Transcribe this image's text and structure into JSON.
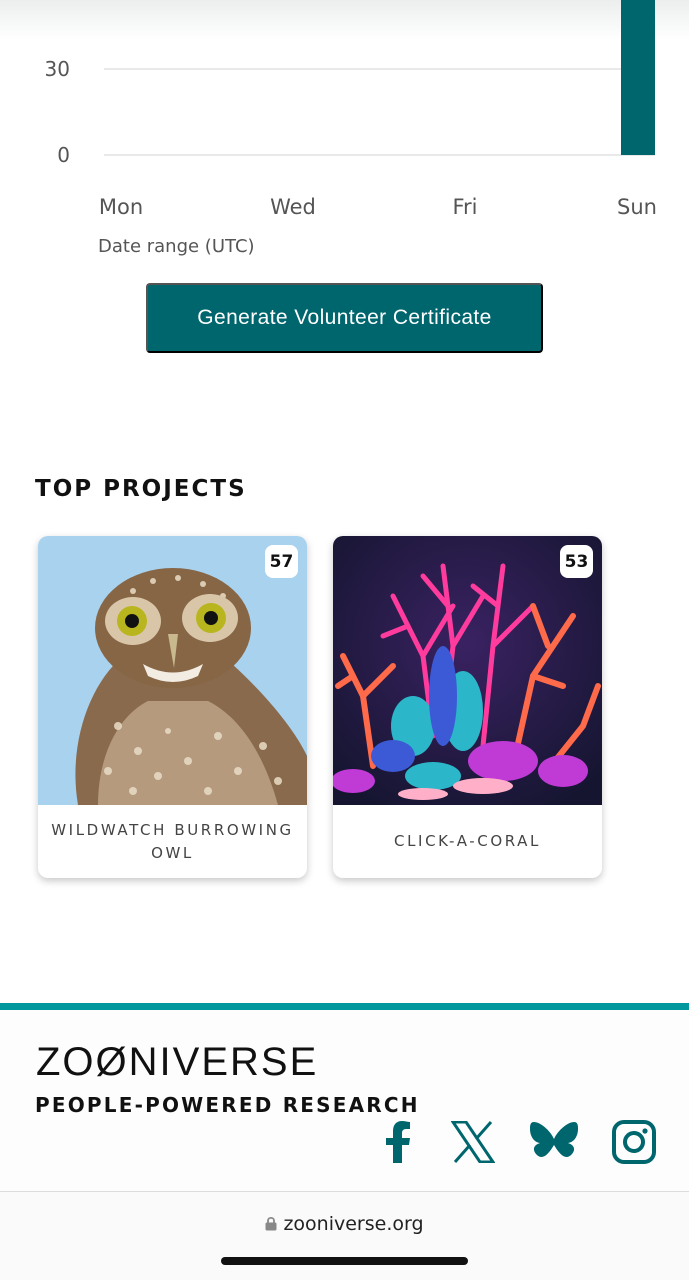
{
  "chart_data": {
    "type": "bar",
    "categories": [
      "Mon",
      "Wed",
      "Fri",
      "Sun"
    ],
    "values": [
      0,
      0,
      0,
      95
    ],
    "xlabel": "Date range (UTC)",
    "yticks": [
      "30",
      "0"
    ],
    "ytick_values": [
      30,
      0
    ],
    "ylim": [
      0,
      90
    ],
    "grid": true,
    "bar_color": "#00666e"
  },
  "actions": {
    "certificate_label": "Generate Volunteer Certificate"
  },
  "top_projects": {
    "title": "TOP PROJECTS",
    "items": [
      {
        "name": "WILDWATCH BURROWING OWL",
        "count": "57"
      },
      {
        "name": "CLICK-A-CORAL",
        "count": "53"
      }
    ]
  },
  "footer": {
    "logo": "ZOØNIVERSE",
    "tagline": "PEOPLE-POWERED RESEARCH",
    "social_icons": [
      "facebook-icon",
      "x-icon",
      "bluesky-icon",
      "instagram-icon"
    ],
    "accent": "#00979d"
  },
  "browser": {
    "url": "zooniverse.org"
  }
}
